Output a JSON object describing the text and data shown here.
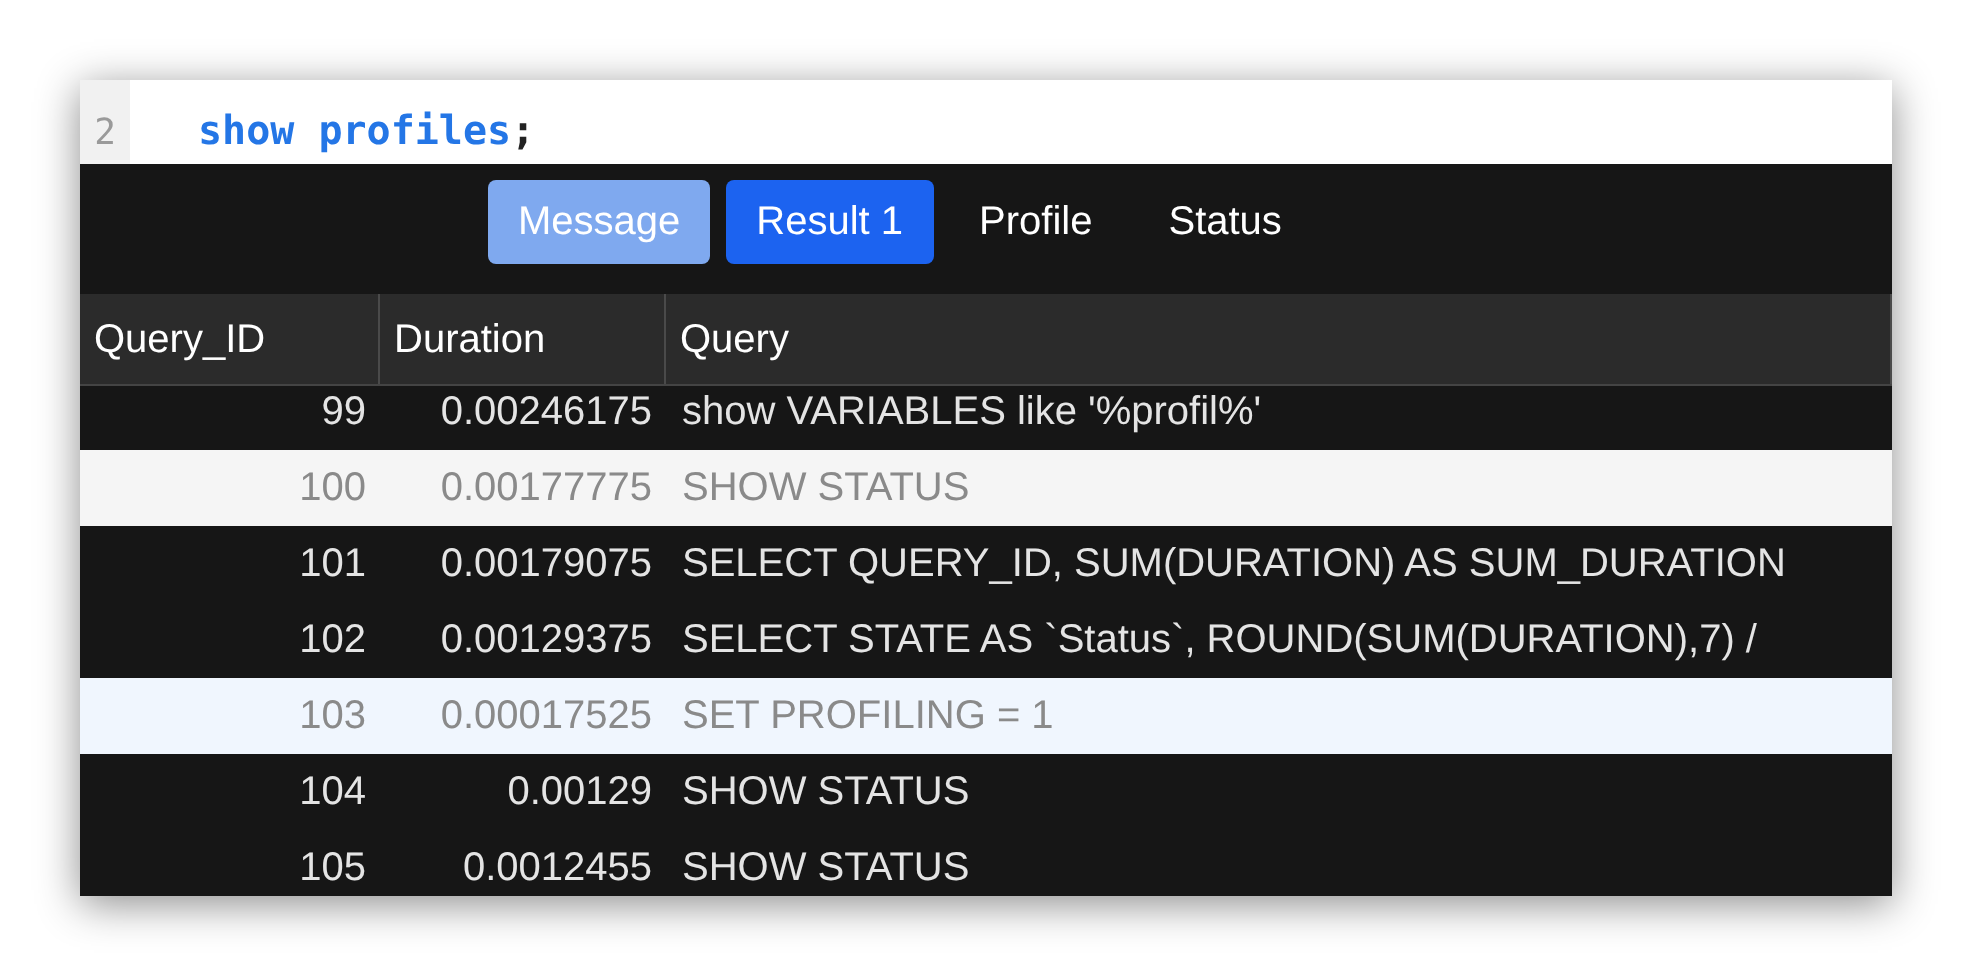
{
  "editor": {
    "line_number": "2",
    "keyword": "show profiles",
    "punctuation": ";"
  },
  "tabs": [
    {
      "label": "Message",
      "selected": false,
      "kind": "pale"
    },
    {
      "label": "Result 1",
      "selected": true,
      "kind": "pale"
    },
    {
      "label": "Profile",
      "selected": false,
      "kind": "plain"
    },
    {
      "label": "Status",
      "selected": false,
      "kind": "plain"
    }
  ],
  "table": {
    "columns": [
      "Query_ID",
      "Duration",
      "Query"
    ],
    "rows": [
      {
        "cells": [
          "99",
          "0.00246175",
          "show VARIABLES like '%profil%'"
        ],
        "color": "#161616"
      },
      {
        "cells": [
          "100",
          "0.00177775",
          "SHOW STATUS"
        ],
        "color": "#f5f5f5"
      },
      {
        "cells": [
          "101",
          "0.00179075",
          "SELECT QUERY_ID, SUM(DURATION) AS SUM_DURATION"
        ],
        "color": "#161616"
      },
      {
        "cells": [
          "102",
          "0.00129375",
          "SELECT STATE AS `Status`, ROUND(SUM(DURATION),7) /"
        ],
        "color": "#161616"
      },
      {
        "cells": [
          "103",
          "0.00017525",
          "SET PROFILING = 1"
        ],
        "color": "#f0f6fe"
      },
      {
        "cells": [
          "104",
          "0.00129",
          "SHOW STATUS"
        ],
        "color": "#161616"
      },
      {
        "cells": [
          "105",
          "0.0012455",
          "SHOW STATUS"
        ],
        "color": "#161616"
      }
    ]
  }
}
